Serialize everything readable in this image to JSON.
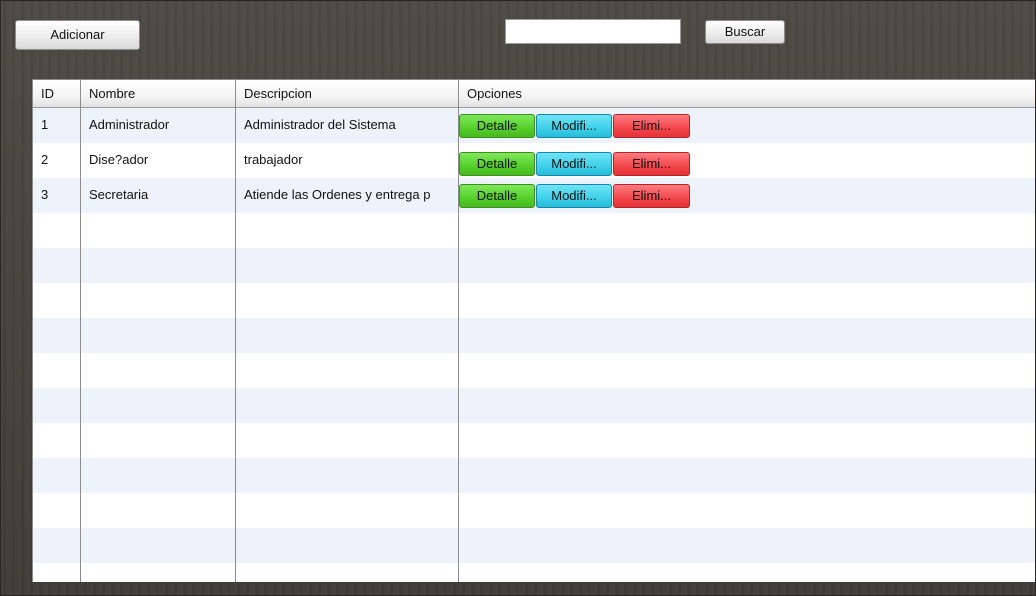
{
  "toolbar": {
    "add_label": "Adicionar",
    "search_value": "",
    "search_label": "Buscar"
  },
  "table": {
    "columns": [
      "ID",
      "Nombre",
      "Descripcion",
      "Opciones"
    ],
    "rows": [
      {
        "id": "1",
        "nombre": "Administrador",
        "descripcion": "Administrador del Sistema"
      },
      {
        "id": "2",
        "nombre": "Dise?ador",
        "descripcion": "trabajador"
      },
      {
        "id": "3",
        "nombre": "Secretaria",
        "descripcion": "Atiende las Ordenes y entrega p"
      }
    ],
    "actions": {
      "detail_label": "Detalle",
      "modify_label": "Modifi...",
      "delete_label": "Elimi..."
    }
  },
  "colors": {
    "background": "#46423d",
    "row_alt": "#eef3fb",
    "detail_button": "#56cf2b",
    "modify_button": "#3fcfe9",
    "delete_button": "#f3474c"
  }
}
